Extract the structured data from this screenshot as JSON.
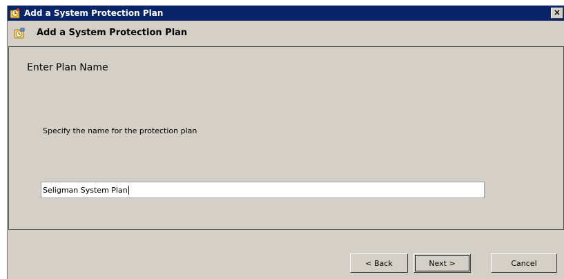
{
  "window": {
    "title": "Add a System Protection Plan",
    "close_glyph": "×"
  },
  "header": {
    "title": "Add a System Protection Plan"
  },
  "step": {
    "title": "Enter Plan Name",
    "prompt": "Specify the name for the protection plan"
  },
  "plan_name": {
    "value": "Seligman System Plan"
  },
  "buttons": {
    "back": "< Back",
    "next": "Next >",
    "cancel": "Cancel"
  },
  "colors": {
    "titlebar": "#0a246a",
    "dialog_bg": "#d4d0c8"
  }
}
